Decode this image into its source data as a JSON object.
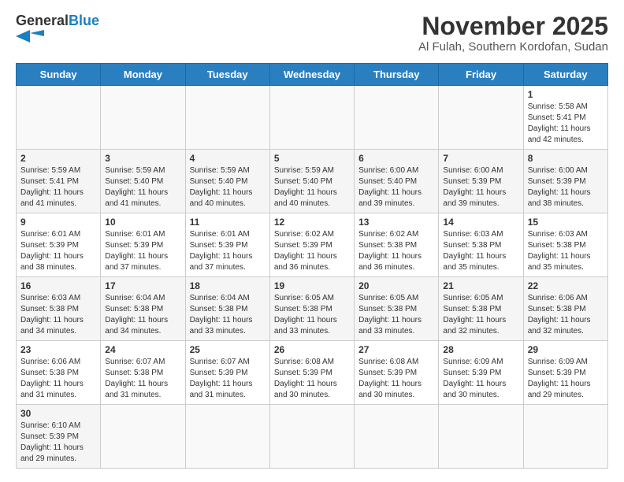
{
  "header": {
    "logo_general": "General",
    "logo_blue": "Blue",
    "month_title": "November 2025",
    "location": "Al Fulah, Southern Kordofan, Sudan"
  },
  "weekdays": [
    "Sunday",
    "Monday",
    "Tuesday",
    "Wednesday",
    "Thursday",
    "Friday",
    "Saturday"
  ],
  "weeks": [
    [
      {
        "day": "",
        "info": ""
      },
      {
        "day": "",
        "info": ""
      },
      {
        "day": "",
        "info": ""
      },
      {
        "day": "",
        "info": ""
      },
      {
        "day": "",
        "info": ""
      },
      {
        "day": "",
        "info": ""
      },
      {
        "day": "1",
        "info": "Sunrise: 5:58 AM\nSunset: 5:41 PM\nDaylight: 11 hours\nand 42 minutes."
      }
    ],
    [
      {
        "day": "2",
        "info": "Sunrise: 5:59 AM\nSunset: 5:41 PM\nDaylight: 11 hours\nand 41 minutes."
      },
      {
        "day": "3",
        "info": "Sunrise: 5:59 AM\nSunset: 5:40 PM\nDaylight: 11 hours\nand 41 minutes."
      },
      {
        "day": "4",
        "info": "Sunrise: 5:59 AM\nSunset: 5:40 PM\nDaylight: 11 hours\nand 40 minutes."
      },
      {
        "day": "5",
        "info": "Sunrise: 5:59 AM\nSunset: 5:40 PM\nDaylight: 11 hours\nand 40 minutes."
      },
      {
        "day": "6",
        "info": "Sunrise: 6:00 AM\nSunset: 5:40 PM\nDaylight: 11 hours\nand 39 minutes."
      },
      {
        "day": "7",
        "info": "Sunrise: 6:00 AM\nSunset: 5:39 PM\nDaylight: 11 hours\nand 39 minutes."
      },
      {
        "day": "8",
        "info": "Sunrise: 6:00 AM\nSunset: 5:39 PM\nDaylight: 11 hours\nand 38 minutes."
      }
    ],
    [
      {
        "day": "9",
        "info": "Sunrise: 6:01 AM\nSunset: 5:39 PM\nDaylight: 11 hours\nand 38 minutes."
      },
      {
        "day": "10",
        "info": "Sunrise: 6:01 AM\nSunset: 5:39 PM\nDaylight: 11 hours\nand 37 minutes."
      },
      {
        "day": "11",
        "info": "Sunrise: 6:01 AM\nSunset: 5:39 PM\nDaylight: 11 hours\nand 37 minutes."
      },
      {
        "day": "12",
        "info": "Sunrise: 6:02 AM\nSunset: 5:39 PM\nDaylight: 11 hours\nand 36 minutes."
      },
      {
        "day": "13",
        "info": "Sunrise: 6:02 AM\nSunset: 5:38 PM\nDaylight: 11 hours\nand 36 minutes."
      },
      {
        "day": "14",
        "info": "Sunrise: 6:03 AM\nSunset: 5:38 PM\nDaylight: 11 hours\nand 35 minutes."
      },
      {
        "day": "15",
        "info": "Sunrise: 6:03 AM\nSunset: 5:38 PM\nDaylight: 11 hours\nand 35 minutes."
      }
    ],
    [
      {
        "day": "16",
        "info": "Sunrise: 6:03 AM\nSunset: 5:38 PM\nDaylight: 11 hours\nand 34 minutes."
      },
      {
        "day": "17",
        "info": "Sunrise: 6:04 AM\nSunset: 5:38 PM\nDaylight: 11 hours\nand 34 minutes."
      },
      {
        "day": "18",
        "info": "Sunrise: 6:04 AM\nSunset: 5:38 PM\nDaylight: 11 hours\nand 33 minutes."
      },
      {
        "day": "19",
        "info": "Sunrise: 6:05 AM\nSunset: 5:38 PM\nDaylight: 11 hours\nand 33 minutes."
      },
      {
        "day": "20",
        "info": "Sunrise: 6:05 AM\nSunset: 5:38 PM\nDaylight: 11 hours\nand 33 minutes."
      },
      {
        "day": "21",
        "info": "Sunrise: 6:05 AM\nSunset: 5:38 PM\nDaylight: 11 hours\nand 32 minutes."
      },
      {
        "day": "22",
        "info": "Sunrise: 6:06 AM\nSunset: 5:38 PM\nDaylight: 11 hours\nand 32 minutes."
      }
    ],
    [
      {
        "day": "23",
        "info": "Sunrise: 6:06 AM\nSunset: 5:38 PM\nDaylight: 11 hours\nand 31 minutes."
      },
      {
        "day": "24",
        "info": "Sunrise: 6:07 AM\nSunset: 5:38 PM\nDaylight: 11 hours\nand 31 minutes."
      },
      {
        "day": "25",
        "info": "Sunrise: 6:07 AM\nSunset: 5:39 PM\nDaylight: 11 hours\nand 31 minutes."
      },
      {
        "day": "26",
        "info": "Sunrise: 6:08 AM\nSunset: 5:39 PM\nDaylight: 11 hours\nand 30 minutes."
      },
      {
        "day": "27",
        "info": "Sunrise: 6:08 AM\nSunset: 5:39 PM\nDaylight: 11 hours\nand 30 minutes."
      },
      {
        "day": "28",
        "info": "Sunrise: 6:09 AM\nSunset: 5:39 PM\nDaylight: 11 hours\nand 30 minutes."
      },
      {
        "day": "29",
        "info": "Sunrise: 6:09 AM\nSunset: 5:39 PM\nDaylight: 11 hours\nand 29 minutes."
      }
    ],
    [
      {
        "day": "30",
        "info": "Sunrise: 6:10 AM\nSunset: 5:39 PM\nDaylight: 11 hours\nand 29 minutes."
      },
      {
        "day": "",
        "info": ""
      },
      {
        "day": "",
        "info": ""
      },
      {
        "day": "",
        "info": ""
      },
      {
        "day": "",
        "info": ""
      },
      {
        "day": "",
        "info": ""
      },
      {
        "day": "",
        "info": ""
      }
    ]
  ]
}
